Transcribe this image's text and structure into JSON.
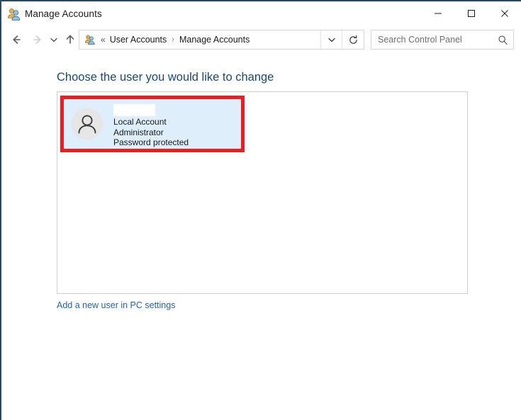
{
  "window": {
    "title": "Manage Accounts",
    "title_icon": "user-accounts-icon",
    "frame_color": "#1f4e63"
  },
  "caption_buttons": {
    "minimize": {
      "label": "Minimize",
      "glyph": "minimize-icon"
    },
    "maximize": {
      "label": "Maximize",
      "glyph": "maximize-icon"
    },
    "close": {
      "label": "Close",
      "glyph": "close-icon"
    }
  },
  "navbar": {
    "back": {
      "name": "back-arrow-icon",
      "enabled": true
    },
    "forward": {
      "name": "forward-arrow-icon",
      "enabled": false
    },
    "recent": {
      "name": "chevron-down-icon",
      "enabled": true
    },
    "up": {
      "name": "up-arrow-icon",
      "enabled": true
    },
    "breadcrumb": {
      "icon": "user-accounts-icon",
      "overflow": "«",
      "separator": "›",
      "items": [
        {
          "label": "User Accounts"
        },
        {
          "label": "Manage Accounts"
        }
      ]
    },
    "dropdown_glyph": "chevron-down-icon",
    "refresh_glyph": "refresh-icon"
  },
  "search": {
    "placeholder": "Search Control Panel",
    "value": "",
    "icon": "search-icon"
  },
  "main": {
    "heading": "Choose the user you would like to change",
    "heading_color": "#17487a",
    "accounts": [
      {
        "name_redacted": true,
        "name": "",
        "type": "Local Account",
        "role": "Administrator",
        "password_status": "Password protected",
        "avatar_icon": "person-avatar-icon",
        "selected": true,
        "highlight_color": "#ee1c20",
        "selection_color": "#deeefb"
      }
    ],
    "add_user_link": "Add a new user in PC settings",
    "link_color": "#2063b0"
  }
}
